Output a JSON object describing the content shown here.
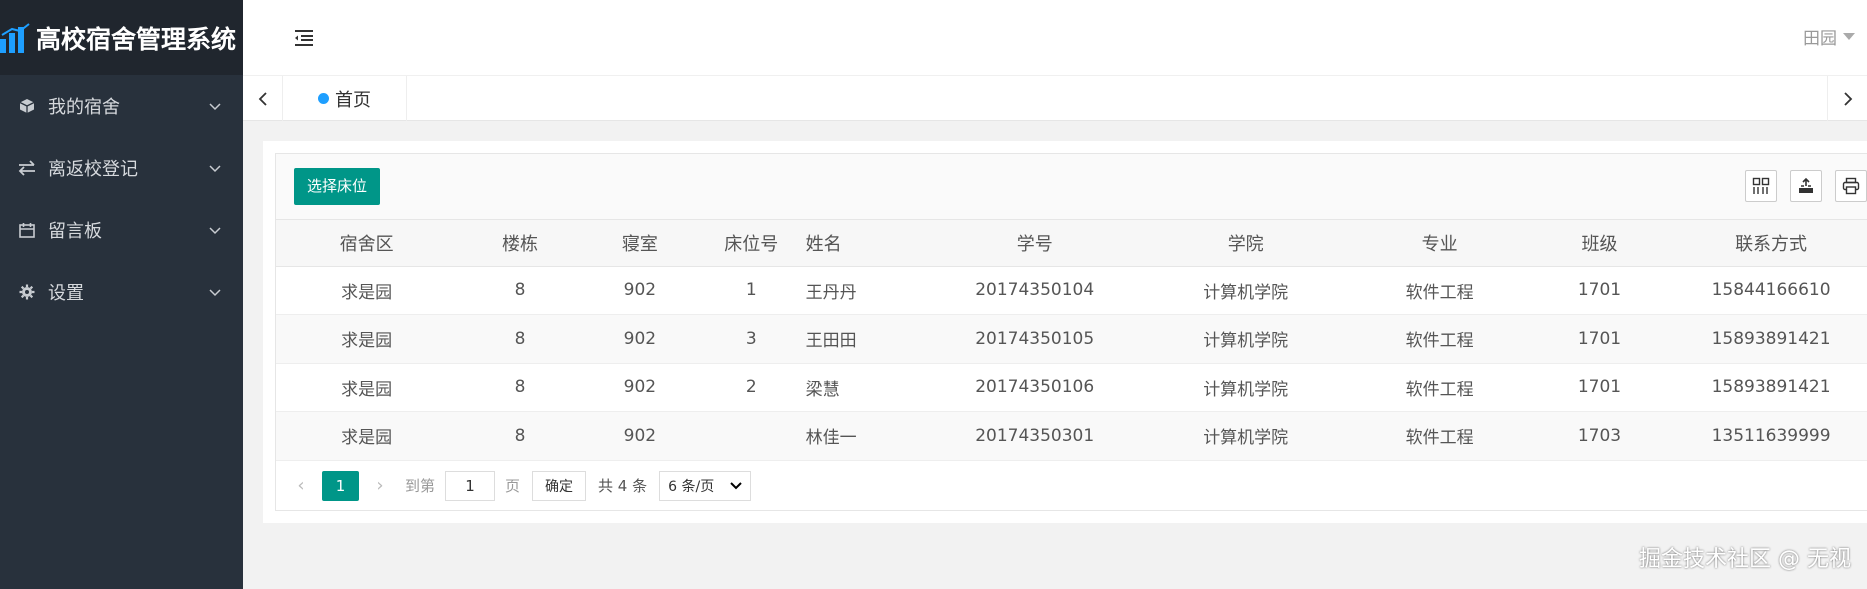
{
  "app": {
    "title": "高校宿舍管理系统"
  },
  "sidebar": {
    "items": [
      {
        "label": "我的宿舍",
        "icon": "cube-icon"
      },
      {
        "label": "离返校登记",
        "icon": "swap-icon"
      },
      {
        "label": "留言板",
        "icon": "calendar-icon"
      },
      {
        "label": "设置",
        "icon": "gear-icon"
      }
    ]
  },
  "header": {
    "user": "田园"
  },
  "tabs": [
    {
      "label": "首页",
      "active": true
    }
  ],
  "toolbar": {
    "select_bed_label": "选择床位"
  },
  "table": {
    "columns": [
      "宿舍区",
      "楼栋",
      "寝室",
      "床位号",
      "姓名",
      "学号",
      "学院",
      "专业",
      "班级",
      "联系方式"
    ],
    "rows": [
      [
        "求是园",
        "8",
        "902",
        "1",
        "王丹丹",
        "20174350104",
        "计算机学院",
        "软件工程",
        "1701",
        "15844166610"
      ],
      [
        "求是园",
        "8",
        "902",
        "3",
        "王田田",
        "20174350105",
        "计算机学院",
        "软件工程",
        "1701",
        "15893891421"
      ],
      [
        "求是园",
        "8",
        "902",
        "2",
        "梁慧",
        "20174350106",
        "计算机学院",
        "软件工程",
        "1701",
        "15893891421"
      ],
      [
        "求是园",
        "8",
        "902",
        "",
        "林佳一",
        "20174350301",
        "计算机学院",
        "软件工程",
        "1703",
        "13511639999"
      ]
    ]
  },
  "pager": {
    "current_page": "1",
    "skip_label": "到第",
    "page_input_value": "1",
    "skip_unit": "页",
    "go_label": "确定",
    "count_text": "共 4 条",
    "limit_text": "6 条/页"
  },
  "watermark": "掘金技术社区 @ 无视",
  "colors": {
    "primary": "#009688",
    "sidebar_bg": "#28313c",
    "tab_dot": "#1e9fff"
  }
}
